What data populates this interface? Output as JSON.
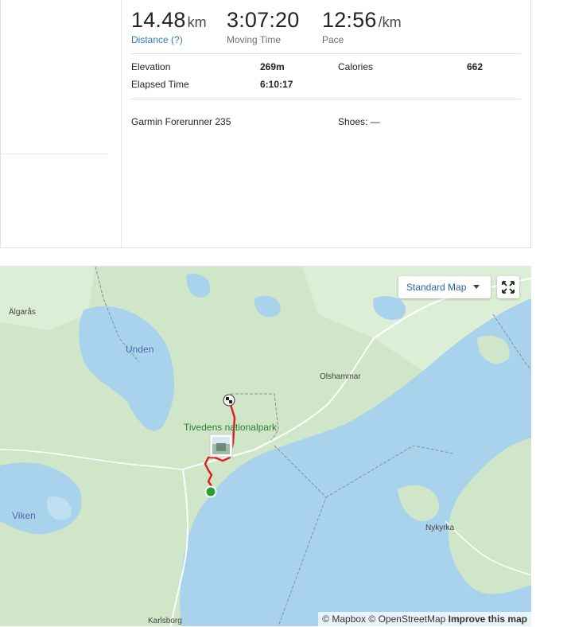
{
  "stats": {
    "distance": {
      "value": "14.48",
      "unit": "km",
      "label": "Distance (?)"
    },
    "moving_time": {
      "value": "3:07:20",
      "label": "Moving Time"
    },
    "pace": {
      "value": "12:56",
      "unit": "/km",
      "label": "Pace"
    }
  },
  "details": {
    "elevation_label": "Elevation",
    "elevation_value": "269m",
    "calories_label": "Calories",
    "calories_value": "662",
    "elapsed_label": "Elapsed Time",
    "elapsed_value": "6:10:17"
  },
  "gear": {
    "device": "Garmin Forerunner 235",
    "shoes_label": "Shoes: —"
  },
  "map": {
    "style_button": "Standard Map",
    "labels": {
      "algaras": "Älgarås",
      "unden": "Unden",
      "olshammar": "Olshammar",
      "park": "Tivedens nationalpark",
      "viken": "Viken",
      "nykyrka": "Nykyrka",
      "karlsborg": "Karlsborg"
    },
    "attribution": {
      "mapbox": "© Mapbox",
      "osm": "© OpenStreetMap",
      "improve": "Improve this map"
    },
    "colors": {
      "land": "#cfe6c8",
      "water": "#a9d2ec",
      "route": "#e02020",
      "start": "#2ca02c"
    }
  }
}
